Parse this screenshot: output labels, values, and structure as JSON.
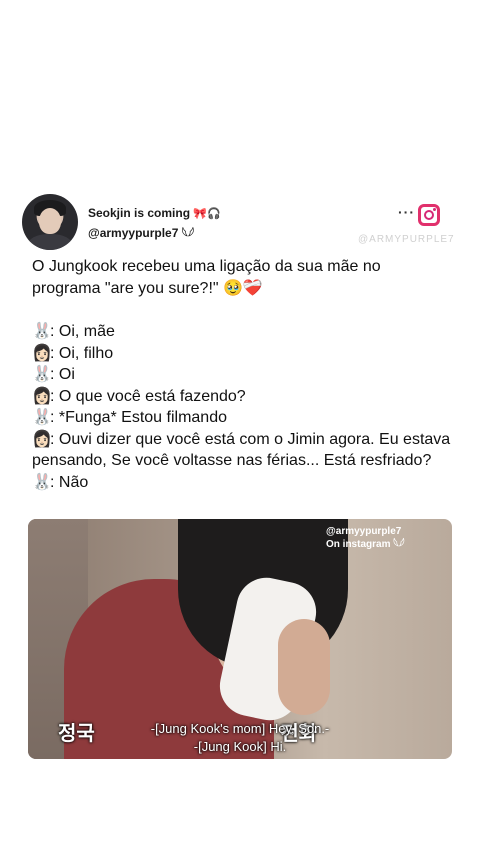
{
  "post": {
    "display_name": "Seokjin is coming",
    "display_name_emoji": "🎀🎧",
    "handle": "@armyypurple7",
    "handle_emoji": "𓆩𓆪",
    "more_icon": "more-dots-icon",
    "platform_icon": "instagram-icon",
    "watermark": "@ARMYPURPLE7"
  },
  "body": {
    "intro": "O Jungkook recebeu uma ligação da sua mãe no programa \"are you sure?!\" 🥹❤️‍🩹",
    "lines": [
      {
        "speaker": "🐰",
        "text": ": Oi, mãe"
      },
      {
        "speaker": "👩🏻",
        "text": ": Oi, filho"
      },
      {
        "speaker": "🐰",
        "text": ": Oi"
      },
      {
        "speaker": "👩🏻",
        "text": ": O que você está fazendo?"
      },
      {
        "speaker": "🐰",
        "text": ": *Funga* Estou filmando"
      },
      {
        "speaker": "👩🏻",
        "text": ": Ouvi dizer que você está com o Jimin agora. Eu estava pensando, Se você voltasse nas férias... Está resfriado?"
      },
      {
        "speaker": "🐰",
        "text": ": Não"
      }
    ]
  },
  "video": {
    "watermark_line1": "@armyypurple7",
    "watermark_line2": "On instagram 𓆩𓆪",
    "korean_caption": "정국 전화",
    "subtitle_line1": "-[Jung Kook's mom] Hey, Son.-",
    "subtitle_line2": "-[Jung Kook] Hi."
  }
}
